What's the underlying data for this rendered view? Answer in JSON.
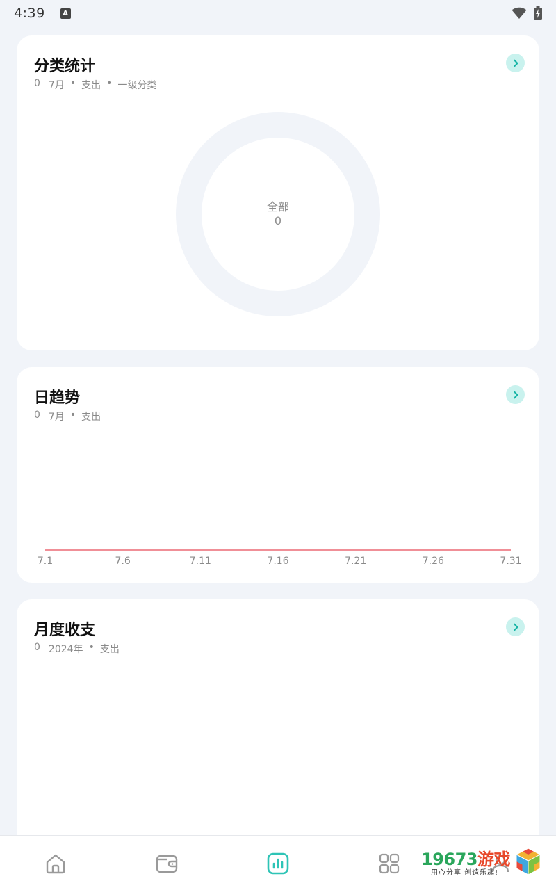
{
  "status_bar": {
    "time": "4:39",
    "app_icon_letter": "A"
  },
  "cards": {
    "category": {
      "title": "分类统计",
      "subtitle": {
        "amount": "0",
        "period": "7月",
        "type": "支出",
        "level": "一级分类"
      },
      "donut": {
        "label": "全部",
        "value": "0"
      }
    },
    "daily": {
      "title": "日趋势",
      "subtitle": {
        "amount": "0",
        "period": "7月",
        "type": "支出"
      },
      "chart_data": {
        "type": "line",
        "title": "",
        "x": [
          "7.1",
          "7.6",
          "7.11",
          "7.16",
          "7.21",
          "7.26",
          "7.31"
        ],
        "series": [
          {
            "values": [
              0,
              0,
              0,
              0,
              0,
              0,
              0
            ]
          }
        ],
        "line_color": "#f08f97"
      }
    },
    "monthly": {
      "title": "月度收支",
      "subtitle": {
        "amount": "0",
        "period": "2024年",
        "type": "支出"
      }
    }
  },
  "bottom_nav": {
    "items": [
      {
        "name": "home",
        "active": false
      },
      {
        "name": "wallet",
        "active": false
      },
      {
        "name": "stats",
        "active": true
      },
      {
        "name": "apps",
        "active": false
      },
      {
        "name": "profile",
        "active": false
      }
    ],
    "active_color": "#2ec4b6",
    "inactive_color": "#9a9a9a"
  },
  "watermark": {
    "number": "19673",
    "cn": "游戏",
    "slogan": "用心分享 创造乐趣!"
  },
  "colors": {
    "accent": "#2ec4b6",
    "arrow_bg": "#c9f2ee",
    "background": "#f1f4f9"
  }
}
